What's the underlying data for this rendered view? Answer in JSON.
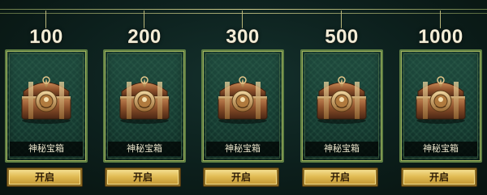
{
  "tiers": [
    {
      "amount": "100",
      "item_name": "神秘宝箱",
      "button_label": "开启"
    },
    {
      "amount": "200",
      "item_name": "神秘宝箱",
      "button_label": "开启"
    },
    {
      "amount": "300",
      "item_name": "神秘宝箱",
      "button_label": "开启"
    },
    {
      "amount": "500",
      "item_name": "神秘宝箱",
      "button_label": "开启"
    },
    {
      "amount": "1000",
      "item_name": "神秘宝箱",
      "button_label": "开启"
    }
  ],
  "icons": {
    "chest": "treasure-chest-icon"
  },
  "colors": {
    "accent_gold": "#e2bd55",
    "card_border": "#5f7f43",
    "card_bg": "#1f4b3e"
  }
}
